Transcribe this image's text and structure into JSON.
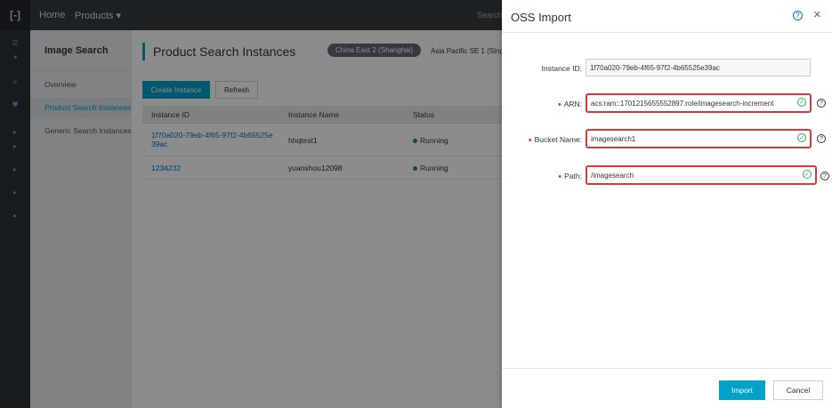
{
  "topbar": {
    "logo": "[-]",
    "home": "Home",
    "products": "Products ▾",
    "search": "Search"
  },
  "subnav": {
    "title": "Image Search",
    "items": [
      {
        "label": "Overview",
        "active": false
      },
      {
        "label": "Product Search Instances",
        "active": true
      },
      {
        "label": "Generic Search Instances",
        "active": false
      }
    ]
  },
  "main": {
    "title": "Product Search Instances",
    "regions": [
      "China East 2 (Shanghai)",
      "Asia Pacific SE 1 (Sing"
    ],
    "create_label": "Create Instance",
    "refresh_label": "Refresh",
    "columns": [
      "Instance ID",
      "Instance Name",
      "Status"
    ],
    "rows": [
      {
        "id_line1": "1f70a020-79eb-4f65-97f2-4b65525e",
        "id_line2": "39ac",
        "name": "hhqtest1",
        "status": "Running"
      },
      {
        "id_line1": "1234232",
        "id_line2": "",
        "name": "yuanshou12098",
        "status": "Running"
      }
    ]
  },
  "dialog": {
    "title": "OSS Import",
    "help_glyph": "?",
    "close_glyph": "×",
    "fields": {
      "instance_id": {
        "label": "Instance ID:",
        "value": "1f70a020-79eb-4f65-97f2-4b65525e39ac"
      },
      "arn": {
        "label": "ARN:",
        "value": "acs:ram::1701215655552897:role/imagesearch-increment"
      },
      "bucket": {
        "label": "Bucket Name:",
        "value": "imagesearch1"
      },
      "path": {
        "label": "Path:",
        "value": "/imagesearch"
      }
    },
    "import_label": "Import",
    "cancel_label": "Cancel"
  },
  "colors": {
    "accent": "#00a2ca",
    "highlight_border": "#d83a3a",
    "valid_check": "#2fb24a",
    "topbar": "#373d41"
  }
}
